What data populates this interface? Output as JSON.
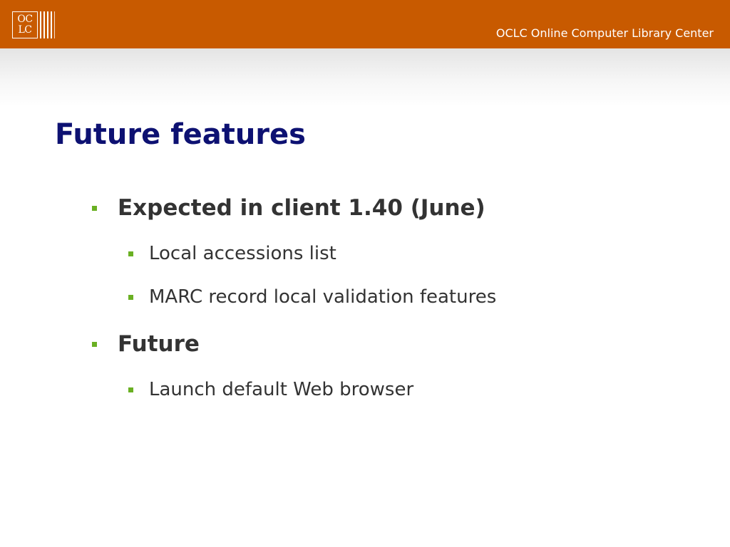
{
  "header": {
    "logo_top": "OC",
    "logo_bottom": "LC",
    "org_name": "OCLC Online Computer Library Center"
  },
  "slide": {
    "title": "Future features",
    "bullets": [
      {
        "level": 1,
        "text": "Expected in client 1.40 (June)"
      },
      {
        "level": 2,
        "text": "Local accessions list"
      },
      {
        "level": 2,
        "text": "MARC record local validation features"
      },
      {
        "level": 1,
        "text": "Future"
      },
      {
        "level": 2,
        "text": "Launch default Web browser"
      }
    ]
  },
  "colors": {
    "header_bar": "#c85a00",
    "title": "#0d1172",
    "bullet_marker": "#6ab023",
    "body_text": "#333333"
  }
}
